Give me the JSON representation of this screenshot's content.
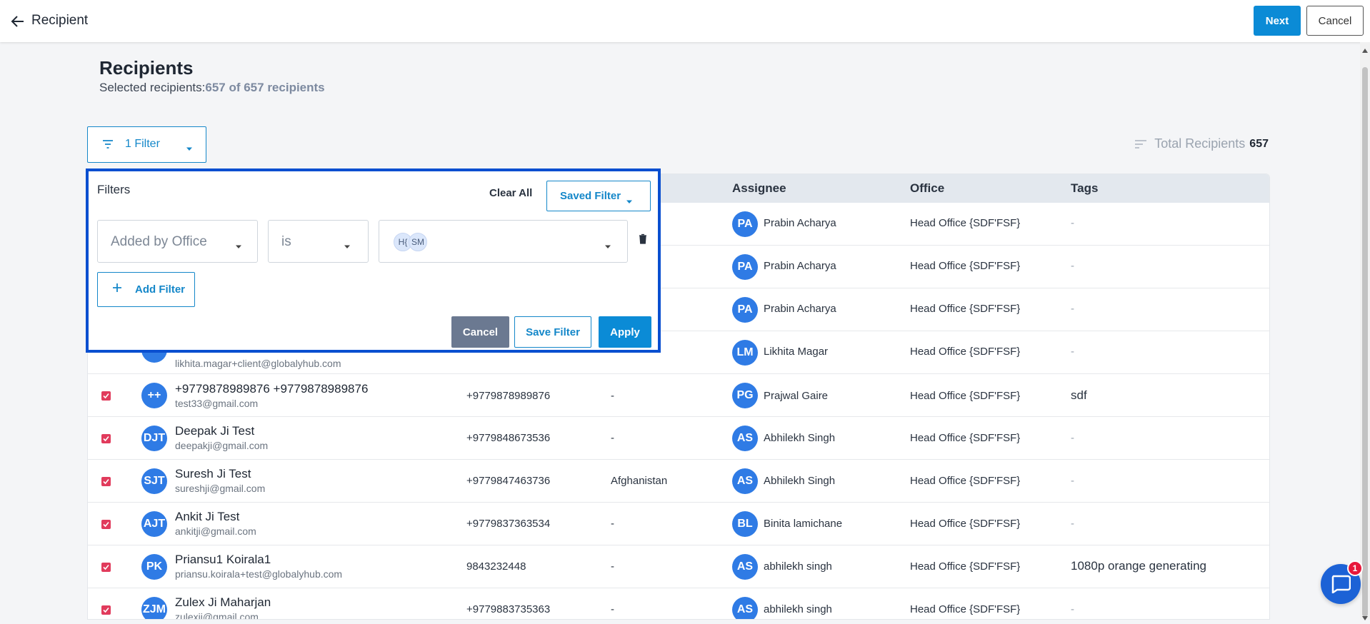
{
  "topbar": {
    "title": "Recipient",
    "next_label": "Next",
    "cancel_label": "Cancel"
  },
  "page": {
    "heading": "Recipients",
    "selected_prefix": "Selected recipients:",
    "selected_count": "657 of 657 recipients",
    "filter_button_label": "1 Filter",
    "total_label": "Total Recipients",
    "total_value": "657"
  },
  "filter_panel": {
    "title": "Filters",
    "clear_all": "Clear All",
    "saved_filter": "Saved Filter",
    "field_value": "Added by Office",
    "operator_value": "is",
    "chips": [
      "H{",
      "SM"
    ],
    "add_filter": "Add Filter",
    "cancel": "Cancel",
    "save_filter": "Save Filter",
    "apply": "Apply"
  },
  "table": {
    "headers": {
      "assignee": "Assignee",
      "office": "Office",
      "tags": "Tags"
    },
    "rows": [
      {
        "assignee_initials": "PA",
        "assignee": "Prabin Acharya",
        "office": "Head Office {SDF'FSF}",
        "tags": "-"
      },
      {
        "assignee_initials": "PA",
        "assignee": "Prabin Acharya",
        "office": "Head Office {SDF'FSF}",
        "tags": "-"
      },
      {
        "assignee_initials": "PA",
        "assignee": "Prabin Acharya",
        "office": "Head Office {SDF'FSF}",
        "tags": "-"
      },
      {
        "email": "likhita.magar+client@globalyhub.com",
        "assignee_initials": "LM",
        "assignee": "Likhita Magar",
        "office": "Head Office {SDF'FSF}",
        "tags": "-"
      },
      {
        "initials": "++",
        "name": "+9779878989876 +9779878989876",
        "email": "test33@gmail.com",
        "phone": "+9779878989876",
        "country": "-",
        "assignee_initials": "PG",
        "assignee": "Prajwal Gaire",
        "office": "Head Office {SDF'FSF}",
        "tags": "sdf"
      },
      {
        "initials": "DJT",
        "name": "Deepak Ji Test",
        "email": "deepakji@gmail.com",
        "phone": "+9779848673536",
        "country": "-",
        "assignee_initials": "AS",
        "assignee": "Abhilekh Singh",
        "office": "Head Office {SDF'FSF}",
        "tags": "-"
      },
      {
        "initials": "SJT",
        "name": "Suresh Ji Test",
        "email": "sureshji@gmail.com",
        "phone": "+9779847463736",
        "country": "Afghanistan",
        "assignee_initials": "AS",
        "assignee": "Abhilekh Singh",
        "office": "Head Office {SDF'FSF}",
        "tags": "-"
      },
      {
        "initials": "AJT",
        "name": "Ankit Ji Test",
        "email": "ankitji@gmail.com",
        "phone": "+9779837363534",
        "country": "-",
        "assignee_initials": "BL",
        "assignee": "Binita lamichane",
        "office": "Head Office {SDF'FSF}",
        "tags": "-"
      },
      {
        "initials": "PK",
        "name": "Priansu1 Koirala1",
        "email": "priansu.koirala+test@globalyhub.com",
        "phone": "9843232448",
        "country": "-",
        "assignee_initials": "AS",
        "assignee": "abhilekh singh",
        "office": "Head Office {SDF'FSF}",
        "tags": "1080p orange generating"
      },
      {
        "initials": "ZJM",
        "name": "Zulex Ji Maharjan",
        "email": "zulexji@gmail.com",
        "phone": "+9779883735363",
        "country": "-",
        "assignee_initials": "AS",
        "assignee": "abhilekh singh",
        "office": "Head Office {SDF'FSF}",
        "tags": "-"
      }
    ]
  },
  "chat": {
    "badge": "1"
  },
  "colors": {
    "primary": "#0b8bd6",
    "avatar": "#2f7be5",
    "checkbox": "#e13b5c",
    "panel_border": "#0a4fd0"
  }
}
